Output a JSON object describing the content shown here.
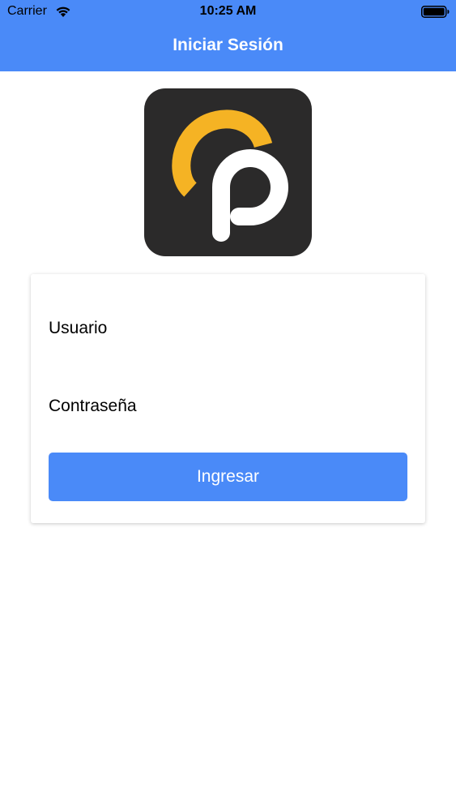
{
  "status_bar": {
    "carrier": "Carrier",
    "time": "10:25 AM",
    "wifi_icon": "wifi-icon",
    "battery_icon": "battery-full-icon"
  },
  "header": {
    "title": "Iniciar Sesión"
  },
  "logo": {
    "icon": "app-logo-cp",
    "colors": {
      "background": "#2b2a2a",
      "arc": "#f5b324",
      "letter": "#ffffff"
    }
  },
  "form": {
    "username_placeholder": "Usuario",
    "username_value": "",
    "password_placeholder": "Contraseña",
    "password_value": "",
    "submit_label": "Ingresar"
  },
  "colors": {
    "accent": "#4a8af8"
  }
}
